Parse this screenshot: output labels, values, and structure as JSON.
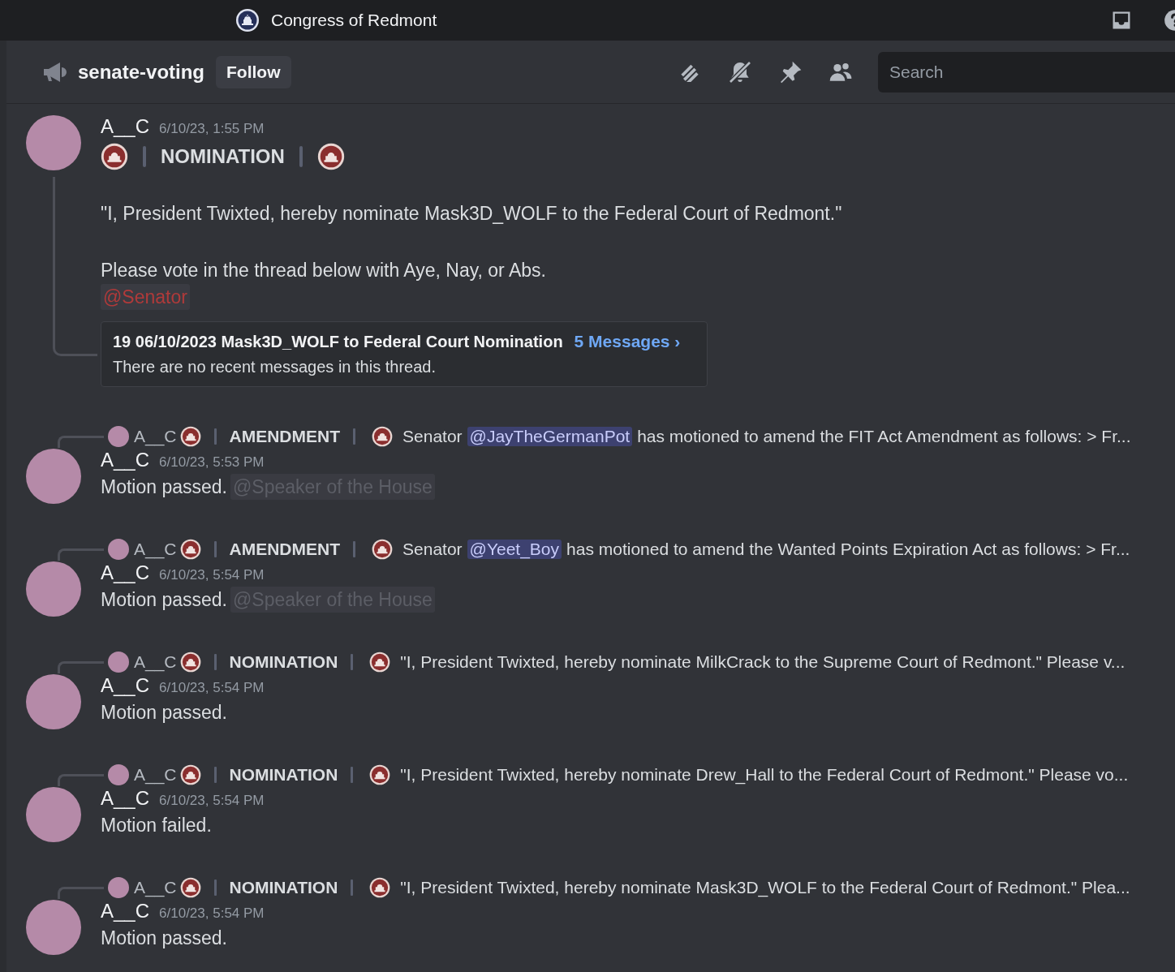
{
  "server": {
    "title": "Congress of Redmont"
  },
  "channel": {
    "name": "senate-voting",
    "follow": "Follow",
    "search": {
      "placeholder": "Search"
    }
  },
  "post": {
    "author": "A__C",
    "time": "6/10/23, 1:55 PM",
    "heading": "NOMINATION",
    "quote": "\"I, President Twixted, hereby nominate Mask3D_WOLF to the Federal Court of Redmont.\"",
    "vote_line": "Please vote in the thread below with Aye, Nay, or Abs.",
    "mention": {
      "text": "@Senator",
      "color": "#b03a3a"
    },
    "thread": {
      "title": "19 06/10/2023 Mask3D_WOLF to Federal Court Nomination",
      "link": "5 Messages ›",
      "preview": "There are no recent messages in this thread."
    }
  },
  "messages": [
    {
      "reply": {
        "author": "A__C",
        "heading": "AMENDMENT",
        "parts": [
          {
            "kind": "text",
            "text": "Senator"
          },
          {
            "kind": "mention",
            "text": "@JayTheGermanPot"
          },
          {
            "kind": "text",
            "text": "has motioned to amend the FIT Act Amendment as follows:  > Fr..."
          }
        ]
      },
      "author": "A__C",
      "time": "6/10/23, 5:53 PM",
      "text": "Motion passed.",
      "mention": {
        "text": "@Speaker of the House",
        "color": "#5c5e66"
      }
    },
    {
      "reply": {
        "author": "A__C",
        "heading": "AMENDMENT",
        "parts": [
          {
            "kind": "text",
            "text": "Senator"
          },
          {
            "kind": "mention",
            "text": "@Yeet_Boy"
          },
          {
            "kind": "text",
            "text": "has motioned to amend the Wanted Points Expiration Act as follows:  > Fr..."
          }
        ]
      },
      "author": "A__C",
      "time": "6/10/23, 5:54 PM",
      "text": "Motion passed.",
      "mention": {
        "text": "@Speaker of the House",
        "color": "#5c5e66"
      }
    },
    {
      "reply": {
        "author": "A__C",
        "heading": "NOMINATION",
        "parts": [
          {
            "kind": "text",
            "text": "\"I, President Twixted, hereby nominate MilkCrack to the Supreme Court of Redmont.\"  Please v..."
          }
        ]
      },
      "author": "A__C",
      "time": "6/10/23, 5:54 PM",
      "text": "Motion passed."
    },
    {
      "reply": {
        "author": "A__C",
        "heading": "NOMINATION",
        "parts": [
          {
            "kind": "text",
            "text": "\"I, President Twixted, hereby nominate Drew_Hall to the Federal Court of Redmont.\"  Please vo..."
          }
        ]
      },
      "author": "A__C",
      "time": "6/10/23, 5:54 PM",
      "text": "Motion failed."
    },
    {
      "reply": {
        "author": "A__C",
        "heading": "NOMINATION",
        "parts": [
          {
            "kind": "text",
            "text": "\"I, President Twixted, hereby nominate Mask3D_WOLF to the Federal Court of Redmont.\"  Plea..."
          }
        ]
      },
      "author": "A__C",
      "time": "6/10/23, 5:54 PM",
      "text": "Motion passed."
    }
  ]
}
